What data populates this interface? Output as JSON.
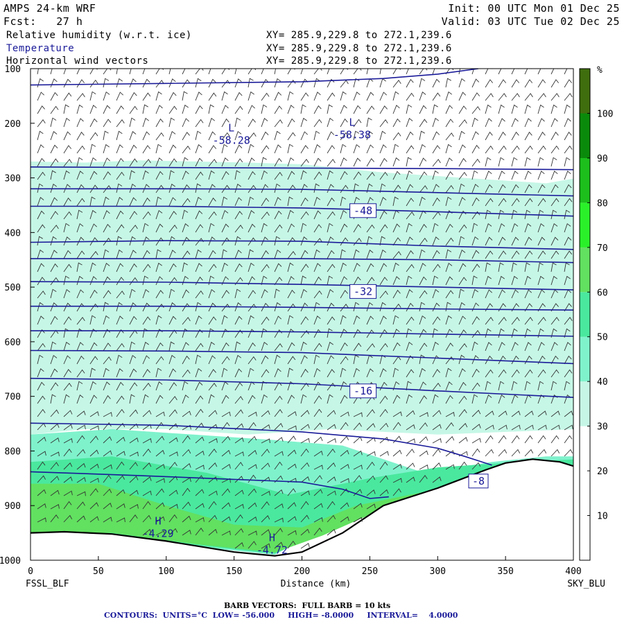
{
  "header": {
    "model": "AMPS 24-km WRF",
    "init": "Init: 00 UTC Mon 01 Dec 25",
    "fcst": "Fcst:   27 h",
    "valid": "Valid: 03 UTC Tue 02 Dec 25",
    "field1": "Relative humidity (w.r.t. ice)",
    "field2": "Temperature",
    "field3": "Horizontal wind vectors",
    "xy1": "XY= 285.9,229.8 to 272.1,239.6",
    "xy2": "XY= 285.9,229.8 to 272.1,239.6",
    "xy3": "XY= 285.9,229.8 to 272.1,239.6"
  },
  "footer": {
    "barb": "BARB VECTORS:  FULL BARB = 10 kts",
    "contours": "CONTOURS:  UNITS=°C  LOW= -56.000     HIGH= -8.0000     INTERVAL=    4.0000"
  },
  "colors": {
    "contour": "#1a1a99",
    "rh_bins": [
      "#ffffff",
      "#ffffff",
      "#ffffff",
      "#c6f7e6",
      "#7ff2cc",
      "#4ae89e",
      "#62e060",
      "#2af02a",
      "#1cbf1c",
      "#0a8a0a",
      "#3f6e0e"
    ]
  },
  "chart_data": {
    "type": "cross-section",
    "x_endpoints": [
      "FSSL_BLF",
      "SKY_BLU"
    ],
    "xlabel": "Distance (km)",
    "ylabel": "",
    "xlim": [
      0,
      400
    ],
    "ylim": [
      1000,
      100
    ],
    "xticks": [
      0,
      50,
      100,
      150,
      200,
      250,
      300,
      350,
      400
    ],
    "yticks": [
      100,
      200,
      300,
      400,
      500,
      600,
      700,
      800,
      900,
      1000
    ],
    "colorbar": {
      "unit": "%",
      "ticks": [
        10,
        20,
        30,
        40,
        50,
        60,
        70,
        80,
        90,
        100
      ],
      "bins": [
        0,
        10,
        20,
        30,
        40,
        50,
        60,
        70,
        80,
        90,
        100,
        110
      ]
    },
    "contour_labels": [
      {
        "text": "-48",
        "x": 245,
        "p": 360
      },
      {
        "text": "-32",
        "x": 245,
        "p": 508
      },
      {
        "text": "-16",
        "x": 245,
        "p": 690
      },
      {
        "text": "-8",
        "x": 330,
        "p": 855
      }
    ],
    "extrema": [
      {
        "mark": "L",
        "value": "-58.28",
        "x": 148,
        "p": 225
      },
      {
        "mark": "L",
        "value": "-58.38",
        "x": 237,
        "p": 215
      },
      {
        "mark": "H",
        "value": "-4.29",
        "x": 94,
        "p": 945
      },
      {
        "mark": "H",
        "value": "-4.72",
        "x": 178,
        "p": 975
      }
    ],
    "isotherms": [
      {
        "value": -56,
        "points": [
          [
            0,
            130
          ],
          [
            100,
            127
          ],
          [
            200,
            124
          ],
          [
            260,
            118
          ],
          [
            300,
            110
          ],
          [
            330,
            100
          ]
        ]
      },
      {
        "value": -52,
        "points": [
          [
            0,
            280
          ],
          [
            100,
            281
          ],
          [
            200,
            282
          ],
          [
            300,
            283
          ],
          [
            400,
            285
          ]
        ]
      },
      {
        "value": -48,
        "points": [
          [
            0,
            320
          ],
          [
            100,
            320
          ],
          [
            200,
            321
          ],
          [
            300,
            327
          ],
          [
            400,
            333
          ]
        ]
      },
      {
        "value": -44,
        "points": [
          [
            0,
            352
          ],
          [
            100,
            352
          ],
          [
            200,
            355
          ],
          [
            300,
            362
          ],
          [
            400,
            370
          ]
        ]
      },
      {
        "value": -40,
        "points": [
          [
            0,
            418
          ],
          [
            100,
            415
          ],
          [
            200,
            416
          ],
          [
            300,
            425
          ],
          [
            400,
            431
          ]
        ]
      },
      {
        "value": -36,
        "points": [
          [
            0,
            448
          ],
          [
            100,
            448
          ],
          [
            200,
            448
          ],
          [
            300,
            450
          ],
          [
            400,
            455
          ]
        ]
      },
      {
        "value": -32,
        "points": [
          [
            0,
            490
          ],
          [
            100,
            491
          ],
          [
            200,
            495
          ],
          [
            300,
            500
          ],
          [
            400,
            505
          ]
        ]
      },
      {
        "value": -28,
        "points": [
          [
            0,
            535
          ],
          [
            100,
            535
          ],
          [
            200,
            537
          ],
          [
            300,
            540
          ],
          [
            400,
            542
          ]
        ]
      },
      {
        "value": -24,
        "points": [
          [
            0,
            580
          ],
          [
            100,
            580
          ],
          [
            200,
            582
          ],
          [
            300,
            586
          ],
          [
            400,
            590
          ]
        ]
      },
      {
        "value": -20,
        "points": [
          [
            0,
            616
          ],
          [
            100,
            617
          ],
          [
            200,
            620
          ],
          [
            300,
            630
          ],
          [
            400,
            640
          ]
        ]
      },
      {
        "value": -16,
        "points": [
          [
            0,
            667
          ],
          [
            100,
            670
          ],
          [
            200,
            677
          ],
          [
            300,
            690
          ],
          [
            400,
            702
          ]
        ]
      },
      {
        "value": -12,
        "points": [
          [
            0,
            749
          ],
          [
            100,
            753
          ],
          [
            200,
            765
          ],
          [
            260,
            778
          ],
          [
            300,
            795
          ],
          [
            320,
            810
          ],
          [
            340,
            826
          ]
        ]
      },
      {
        "value": -8,
        "points": [
          [
            0,
            838
          ],
          [
            80,
            845
          ],
          [
            150,
            852
          ],
          [
            200,
            857
          ],
          [
            230,
            870
          ],
          [
            250,
            887
          ],
          [
            264,
            884
          ]
        ]
      }
    ],
    "terrain": [
      [
        0,
        950
      ],
      [
        25,
        948
      ],
      [
        60,
        952
      ],
      [
        100,
        965
      ],
      [
        150,
        985
      ],
      [
        180,
        992
      ],
      [
        200,
        985
      ],
      [
        230,
        950
      ],
      [
        260,
        900
      ],
      [
        300,
        868
      ],
      [
        335,
        835
      ],
      [
        350,
        822
      ],
      [
        370,
        815
      ],
      [
        390,
        820
      ],
      [
        403,
        830
      ]
    ],
    "rh_regions": [
      {
        "level": 3,
        "points": [
          [
            0,
            270
          ],
          [
            40,
            272
          ],
          [
            80,
            268
          ],
          [
            120,
            270
          ],
          [
            160,
            272
          ],
          [
            200,
            275
          ],
          [
            260,
            290
          ],
          [
            320,
            300
          ],
          [
            380,
            310
          ],
          [
            403,
            300
          ],
          [
            403,
            760
          ],
          [
            300,
            770
          ],
          [
            220,
            760
          ],
          [
            160,
            770
          ],
          [
            100,
            760
          ],
          [
            40,
            760
          ],
          [
            0,
            770
          ]
        ]
      },
      {
        "level": 4,
        "points": [
          [
            0,
            770
          ],
          [
            60,
            760
          ],
          [
            120,
            770
          ],
          [
            180,
            780
          ],
          [
            230,
            790
          ],
          [
            290,
            840
          ],
          [
            340,
            820
          ],
          [
            380,
            810
          ],
          [
            403,
            810
          ],
          [
            403,
            830
          ],
          [
            360,
            816
          ],
          [
            330,
            840
          ],
          [
            280,
            880
          ],
          [
            220,
            935
          ],
          [
            180,
            990
          ],
          [
            120,
            975
          ],
          [
            60,
            952
          ],
          [
            0,
            952
          ]
        ]
      },
      {
        "level": 5,
        "points": [
          [
            0,
            820
          ],
          [
            60,
            810
          ],
          [
            130,
            840
          ],
          [
            190,
            880
          ],
          [
            250,
            850
          ],
          [
            300,
            830
          ],
          [
            360,
            820
          ],
          [
            403,
            815
          ],
          [
            403,
            828
          ],
          [
            360,
            817
          ],
          [
            330,
            845
          ],
          [
            270,
            890
          ],
          [
            215,
            950
          ],
          [
            180,
            988
          ],
          [
            120,
            972
          ],
          [
            60,
            951
          ],
          [
            0,
            951
          ]
        ]
      },
      {
        "level": 6,
        "points": [
          [
            0,
            860
          ],
          [
            50,
            860
          ],
          [
            100,
            900
          ],
          [
            150,
            935
          ],
          [
            200,
            940
          ],
          [
            240,
            900
          ],
          [
            290,
            875
          ],
          [
            403,
            850
          ],
          [
            403,
            829
          ],
          [
            360,
            818
          ],
          [
            330,
            848
          ],
          [
            270,
            895
          ],
          [
            215,
            955
          ],
          [
            180,
            986
          ],
          [
            120,
            970
          ],
          [
            60,
            950
          ],
          [
            0,
            950
          ]
        ]
      }
    ]
  }
}
